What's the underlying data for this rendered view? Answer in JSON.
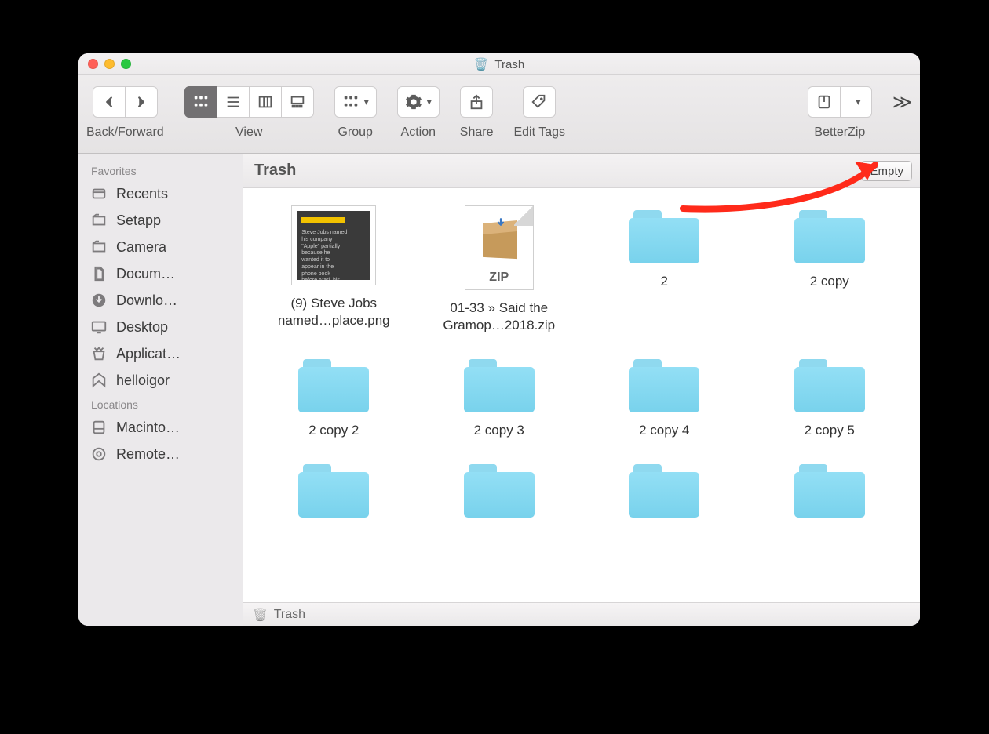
{
  "window": {
    "title": "Trash"
  },
  "toolbar": {
    "backforward_label": "Back/Forward",
    "view_label": "View",
    "group_label": "Group",
    "action_label": "Action",
    "share_label": "Share",
    "edit_tags_label": "Edit Tags",
    "betterzip_label": "BetterZip"
  },
  "sidebar": {
    "sections": [
      {
        "title": "Favorites",
        "items": [
          "Recents",
          "Setapp",
          "Camera",
          "Docum…",
          "Downlo…",
          "Desktop",
          "Applicat…",
          "helloigor"
        ]
      },
      {
        "title": "Locations",
        "items": [
          "Macinto…",
          "Remote…"
        ]
      }
    ]
  },
  "subheader": {
    "title": "Trash",
    "empty_label": "Empty"
  },
  "files": [
    {
      "kind": "image",
      "name": "(9) Steve Jobs\nnamed…place.png"
    },
    {
      "kind": "zip",
      "name": "01-33 » Said the\nGramop…2018.zip",
      "zip_label": "ZIP"
    },
    {
      "kind": "folder",
      "name": "2"
    },
    {
      "kind": "folder",
      "name": "2 copy"
    },
    {
      "kind": "folder",
      "name": "2 copy 2"
    },
    {
      "kind": "folder",
      "name": "2 copy 3"
    },
    {
      "kind": "folder",
      "name": "2 copy 4"
    },
    {
      "kind": "folder",
      "name": "2 copy 5"
    },
    {
      "kind": "folder",
      "name": ""
    },
    {
      "kind": "folder",
      "name": ""
    },
    {
      "kind": "folder",
      "name": ""
    },
    {
      "kind": "folder",
      "name": ""
    }
  ],
  "pathbar": {
    "label": "Trash"
  },
  "imgthumb_text": "Steve Jobs named his company \"Apple\" partially because he wanted it to appear in the phone book before Atari, his former workplace."
}
